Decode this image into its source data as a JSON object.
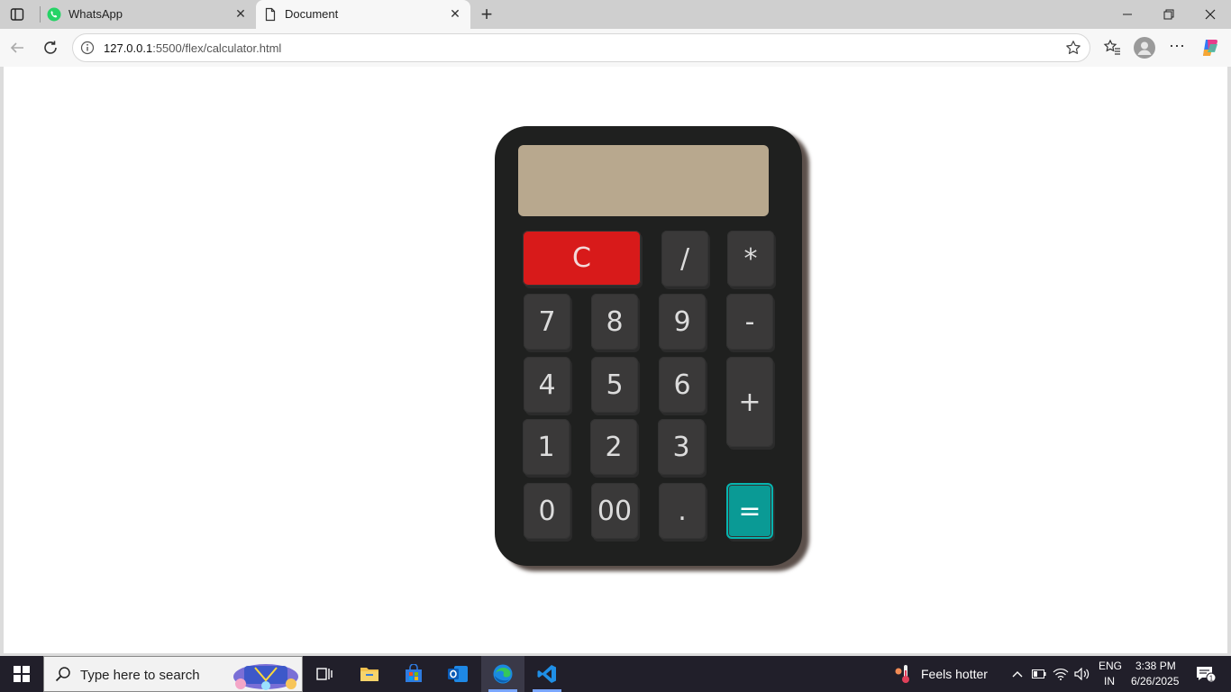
{
  "browser": {
    "tabs": [
      {
        "title": "WhatsApp",
        "active": false
      },
      {
        "title": "Document",
        "active": true
      }
    ],
    "url_host": "127.0.0.1",
    "url_rest": ":5500/flex/calculator.html"
  },
  "calculator": {
    "display_value": "",
    "keys": {
      "clear": "C",
      "divide": "/",
      "multiply": "*",
      "seven": "7",
      "eight": "8",
      "nine": "9",
      "minus": "-",
      "four": "4",
      "five": "5",
      "six": "6",
      "plus": "+",
      "one": "1",
      "two": "2",
      "three": "3",
      "zero": "0",
      "double_zero": "00",
      "dot": ".",
      "equals": "="
    },
    "colors": {
      "body": "#1f201f",
      "display": "#b8a88e",
      "key": "#3a3939",
      "clear": "#d81a1a",
      "equals": "#0a9a95"
    }
  },
  "taskbar": {
    "search_placeholder": "Type here to search",
    "weather": "Feels hotter",
    "lang_top": "ENG",
    "lang_bottom": "IN",
    "time": "3:38 PM",
    "date": "6/26/2025",
    "notification_count": "1"
  }
}
